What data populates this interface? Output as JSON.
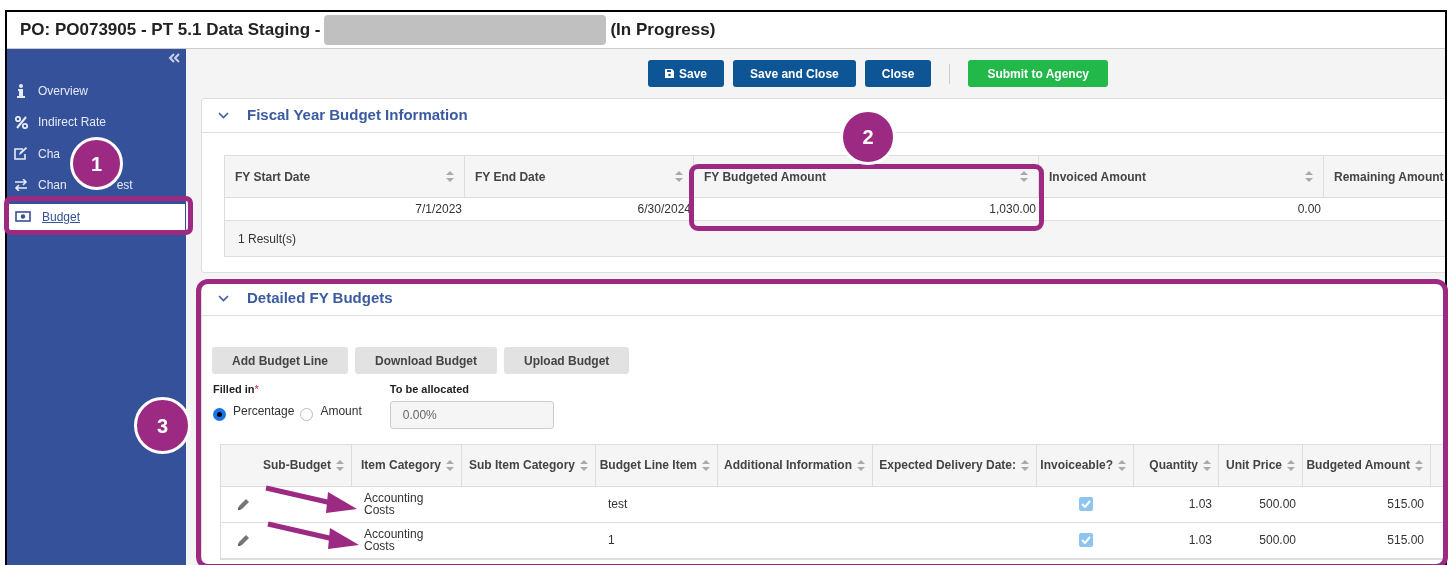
{
  "window": {
    "title": "PO: PO073905 - PT 5.1 Data Staging -",
    "title_suffix": "(In Progress)"
  },
  "sidebar": {
    "items": [
      {
        "label": "Overview",
        "selected": false
      },
      {
        "label": "Indirect Rate",
        "selected": false
      },
      {
        "label": "Cha",
        "selected": false
      },
      {
        "label": "Chan",
        "label_tail": "est",
        "selected": false
      },
      {
        "label": "Budget",
        "selected": true
      }
    ]
  },
  "toolbar": {
    "buttons": [
      {
        "label": "Save",
        "kind": "primary"
      },
      {
        "label": "Save and Close",
        "kind": "primary"
      },
      {
        "label": "Close",
        "kind": "primary"
      },
      {
        "label": "Submit to Agency",
        "kind": "success"
      }
    ]
  },
  "fiscal_panel": {
    "title": "Fiscal Year Budget Information",
    "expanded": true,
    "table": {
      "columns": [
        "FY Start Date",
        "FY End Date",
        "FY Budgeted Amount",
        "Invoiced Amount",
        "Remaining Amount"
      ],
      "rows": [
        [
          "7/1/2023",
          "6/30/2024",
          "1,030.00",
          "0.00",
          ""
        ]
      ]
    },
    "footer": "1 Result(s)"
  },
  "detailed_panel": {
    "title": "Detailed FY Budgets",
    "expanded": true,
    "buttons": [
      "Add Budget Line",
      "Download Budget",
      "Upload Budget"
    ],
    "filled_in": {
      "label": "Filled in",
      "required_mark": "*",
      "options": [
        {
          "label": "Percentage",
          "selected": true
        },
        {
          "label": "Amount",
          "selected": false
        }
      ]
    },
    "to_be_allocated": {
      "label": "To be allocated",
      "value": "0.00%"
    },
    "table": {
      "columns": [
        "Sub-Budget",
        "Item Category",
        "Sub Item Category",
        "Budget Line Item",
        "Additional Information",
        "Expected Delivery Date:",
        "Invoiceable?",
        "Quantity",
        "Unit Price",
        "Budgeted Amount"
      ],
      "rows": [
        {
          "sub_budget": "",
          "item_category": "Accounting Costs",
          "sub_item_category": "",
          "budget_line_item": "test",
          "additional_information": "",
          "expected_delivery_date": "",
          "invoiceable": true,
          "quantity": "1.03",
          "unit_price": "500.00",
          "budgeted_amount": "515.00"
        },
        {
          "sub_budget": "",
          "item_category": "Accounting Costs",
          "sub_item_category": "",
          "budget_line_item": "1",
          "additional_information": "",
          "expected_delivery_date": "",
          "invoiceable": true,
          "quantity": "1.03",
          "unit_price": "500.00",
          "budgeted_amount": "515.00"
        }
      ]
    }
  },
  "callouts": [
    {
      "number": "1"
    },
    {
      "number": "2"
    },
    {
      "number": "3"
    }
  ]
}
